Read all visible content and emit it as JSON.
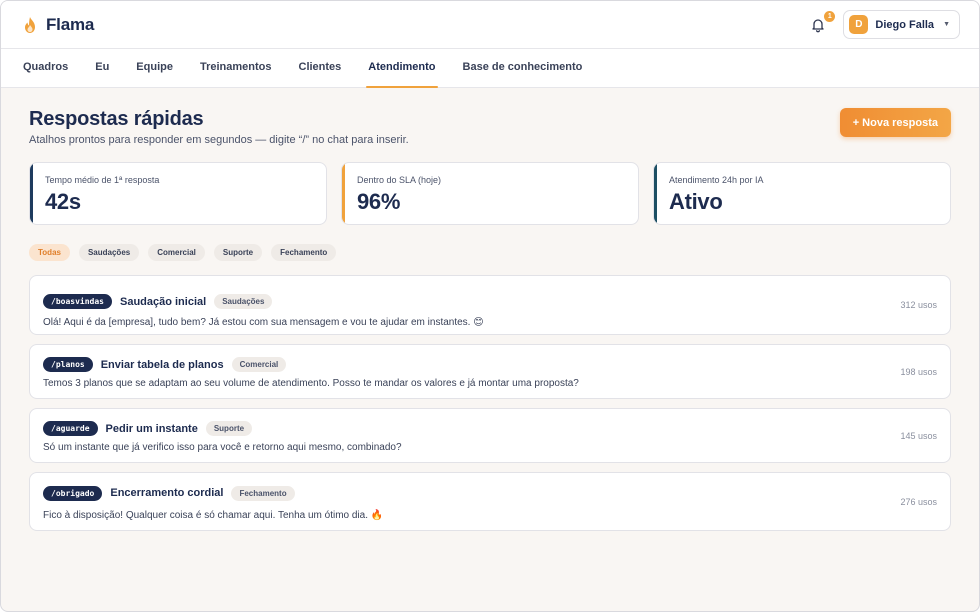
{
  "brand": {
    "name": "Flama",
    "accent": "#f0a23c",
    "navy": "#1d2b4f"
  },
  "header": {
    "notifications_count": "1",
    "user": {
      "initial": "D",
      "name": "Diego Falla"
    }
  },
  "tabs": [
    {
      "label": "Quadros"
    },
    {
      "label": "Eu"
    },
    {
      "label": "Equipe"
    },
    {
      "label": "Treinamentos"
    },
    {
      "label": "Clientes"
    },
    {
      "label": "Atendimento",
      "active": true
    },
    {
      "label": "Base de conhecimento"
    }
  ],
  "page": {
    "title": "Respostas rápidas",
    "subtitle": "Atalhos prontos para responder em segundos — digite “/” no chat para inserir.",
    "new_button": "+ Nova resposta"
  },
  "stats": [
    {
      "label": "Tempo médio de 1ª resposta",
      "value": "42s"
    },
    {
      "label": "Dentro do SLA (hoje)",
      "value": "96%"
    },
    {
      "label": "Atendimento 24h por IA",
      "value": "Ativo"
    }
  ],
  "filters": [
    {
      "label": "Todas",
      "active": true
    },
    {
      "label": "Saudações"
    },
    {
      "label": "Comercial"
    },
    {
      "label": "Suporte"
    },
    {
      "label": "Fechamento"
    }
  ],
  "replies": [
    {
      "command": "/boasvindas",
      "title": "Saudação inicial",
      "tag": "Saudações",
      "text": "Olá! Aqui é da [empresa], tudo bem? Já estou com sua mensagem e vou te ajudar em instantes. 😊",
      "uses": "312 usos"
    },
    {
      "command": "/planos",
      "title": "Enviar tabela de planos",
      "tag": "Comercial",
      "text": "Temos 3 planos que se adaptam ao seu volume de atendimento. Posso te mandar os valores e já montar uma proposta?",
      "uses": "198 usos"
    },
    {
      "command": "/aguarde",
      "title": "Pedir um instante",
      "tag": "Suporte",
      "text": "Só um instante que já verifico isso para você e retorno aqui mesmo, combinado?",
      "uses": "145 usos"
    },
    {
      "command": "/obrigado",
      "title": "Encerramento cordial",
      "tag": "Fechamento",
      "text": "Fico à disposição! Qualquer coisa é só chamar aqui. Tenha um ótimo dia. 🔥",
      "uses": "276 usos"
    }
  ]
}
